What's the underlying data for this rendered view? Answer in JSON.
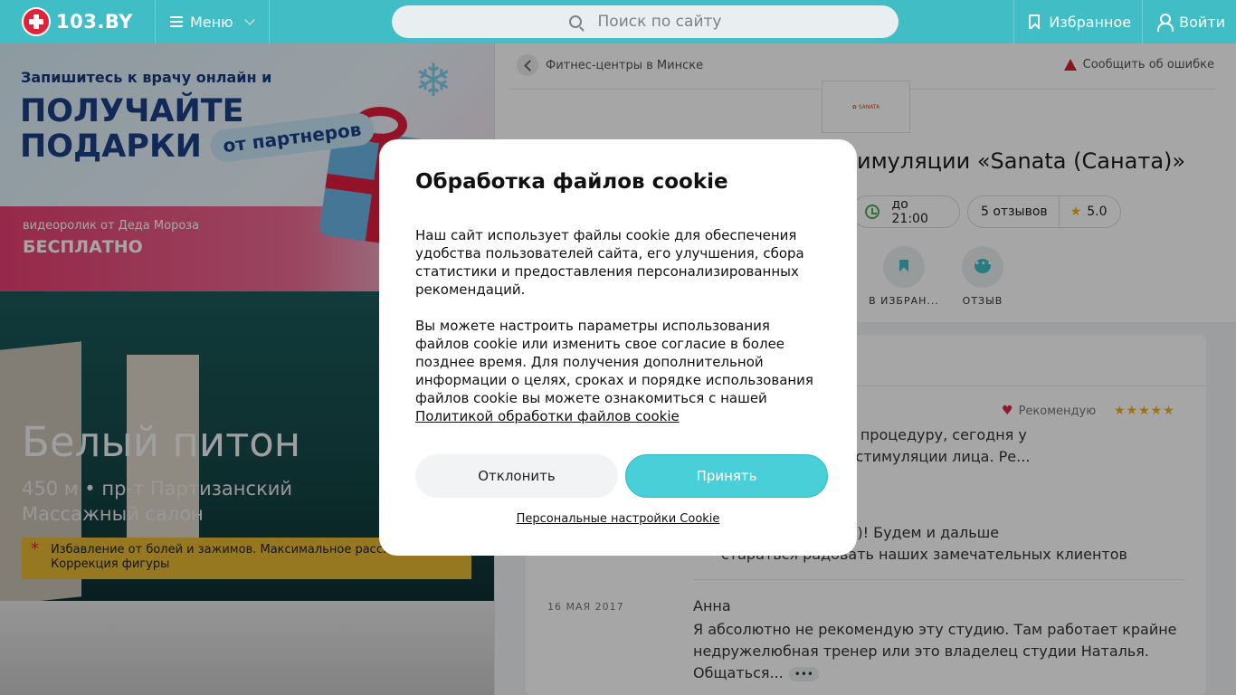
{
  "header": {
    "logo_text": "103.BY",
    "menu_label": "Меню",
    "search_placeholder": "Поиск по сайту",
    "favorites_label": "Избранное",
    "login_label": "Войти",
    "brand_color": "#41bdc5"
  },
  "promo": {
    "line1": "Запишитесь к врачу онлайн и",
    "line2": "ПОЛУЧАЙТЕ",
    "line3": "ПОДАРКИ",
    "badge": "от партнеров",
    "small": "видеоролик от Деда Мороза",
    "free": "БЕСПЛАТНО"
  },
  "venue": {
    "title": "Белый питон",
    "distance_address": "450 м • пр-т Партизанский",
    "category": "Массажный салон",
    "note_line1": "Избавление от болей и зажимов. Максимальное расс...",
    "note_line2": "Коррекция фигуры"
  },
  "page": {
    "breadcrumb": "Фитнес-центры в Минске",
    "report_error": "Сообщить об ошибке",
    "title_fragment": "тимуляции «Sanata (Саната)»",
    "hours": "до 21:00",
    "reviews_count": "5 отзывов",
    "rating": "5.0",
    "action_favorites": "В ИЗБРАН...",
    "action_review": "ОТЗЫВ"
  },
  "reviews": {
    "recommend_label": "Рекомендую",
    "stars": "★★★★★",
    "review1_line1": "рыла для себя новую процедуру, сегодня у",
    "review1_line2": "нс биомеханической стимуляции лица. Ре...",
    "reply_line1": "за добрые слова :)! Будем и дальше",
    "reply_line2": "стараться радовать наших замечательных клиентов",
    "review2_date": "16 МАЯ 2017",
    "review2_author": "Анна",
    "review2_text": "Я абсолютно не рекомендую эту студию. Там работает крайне недружелюбная тренер или это владелец студии Наталья. Общаться...",
    "more_label": "•••"
  },
  "cookie": {
    "title": "Обработка файлов cookie",
    "paragraph1": "Наш сайт использует файлы cookie для обеспечения удобства пользователей сайта, его улучшения, сбора статистики и предоставления персонализированных рекомендаций.",
    "paragraph2": "Вы можете настроить параметры использования файлов cookie или изменить свое согласие в более позднее время. Для получения дополнительной информации о целях, сроках и порядке использования файлов cookie вы можете ознакомиться с нашей",
    "policy_link": "Политикой обработки файлов cookie",
    "decline_label": "Отклонить",
    "accept_label": "Принять",
    "settings_link": "Персональные настройки Cookie",
    "accept_color": "#48cfd7"
  }
}
